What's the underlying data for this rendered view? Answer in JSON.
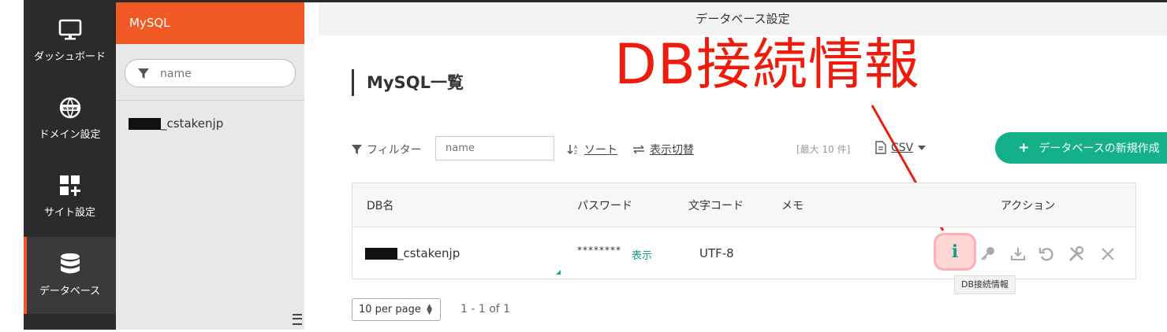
{
  "main_header": {
    "title": "データベース設定"
  },
  "sidebar": {
    "items": [
      {
        "label": "ダッシュボード",
        "icon": "monitor-icon"
      },
      {
        "label": "ドメイン設定",
        "icon": "www-globe-icon"
      },
      {
        "label": "サイト設定",
        "icon": "grid-plus-icon"
      },
      {
        "label": "データベース",
        "icon": "database-icon",
        "active": true
      }
    ]
  },
  "list_panel": {
    "header": "MySQL",
    "search_placeholder": "name",
    "items": [
      {
        "label": "_cstakenjp"
      }
    ]
  },
  "page": {
    "title": "MySQL一覧"
  },
  "annotation": {
    "text": "DB接続情報",
    "color": "#ee1c0c"
  },
  "toolbar": {
    "filter_label": "フィルター",
    "filter_placeholder": "name",
    "sort_label": "ソート",
    "view_label": "表示切替",
    "max_label": "[最大 10 件]",
    "csv_label": "CSV",
    "new_button": "データベースの新規作成"
  },
  "table": {
    "headers": {
      "name": "DB名",
      "password": "パスワード",
      "encoding": "文字コード",
      "memo": "メモ",
      "actions": "アクション"
    },
    "rows": [
      {
        "name": "_cstakenjp",
        "password": "********",
        "show": "表示",
        "encoding": "UTF-8",
        "memo": ""
      }
    ]
  },
  "tooltip": "DB接続情報",
  "pagination": {
    "per_page": "10 per page",
    "range": "1 - 1 of 1"
  },
  "colors": {
    "accent": "#f15a24",
    "primary": "#13b08a",
    "sidebar": "#2b2b2b"
  }
}
